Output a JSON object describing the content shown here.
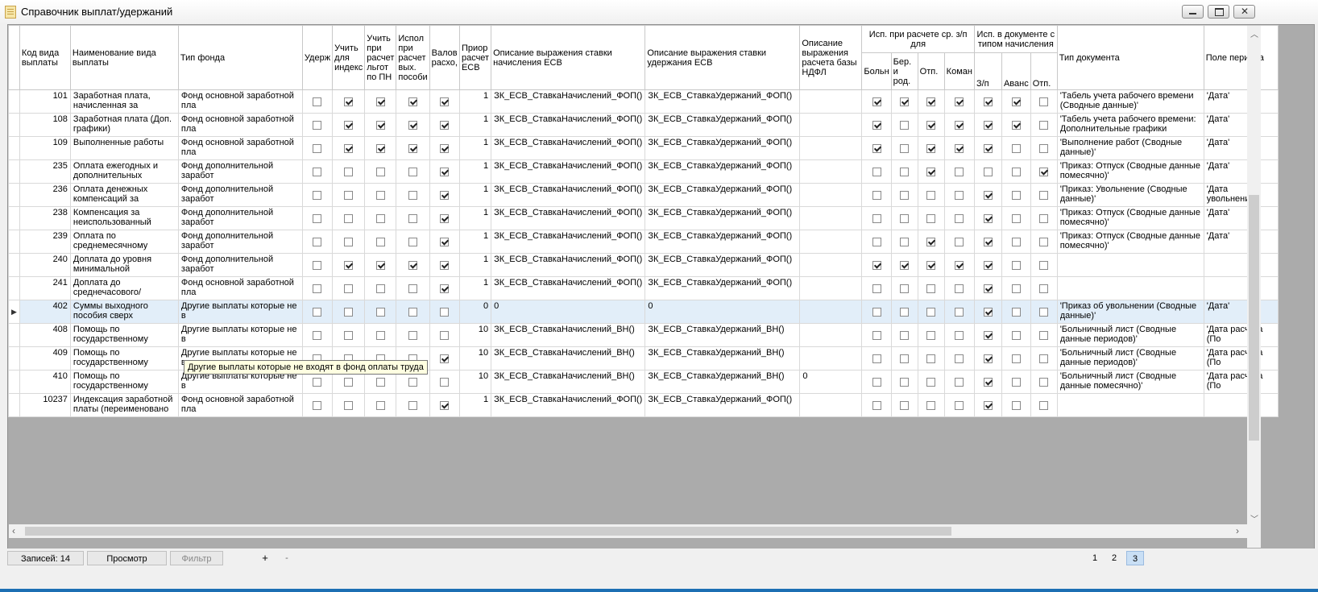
{
  "window": {
    "title": "Справочник выплат/удержаний"
  },
  "columns": {
    "code": "Код вида выплаты",
    "name": "Наименование вида выплаты",
    "fund": "Тип фонда",
    "uderzh": "Удерж",
    "index": "Учить для индекс",
    "lgot": "Учить при расчет льгот по ПН",
    "ispol": "Испол при расчет вых. пособи",
    "valov": "Валов расхо,",
    "prior": "Приор расчет ЕСВ",
    "esv_nach": "Описание выражения ставки начисления ЕСВ",
    "esv_uderzh": "Описание выражения ставки удержания ЕСВ",
    "ndfl": "Описание выражения расчета базы НДФЛ",
    "group_avg": "Исп. при расчете ср. з/п для",
    "boln": "Больн",
    "ber": "Бер. и род.",
    "otp1": "Отп.",
    "koman": "Коман",
    "group_doc": "Исп. в документе с типом начисления",
    "zp": "З/п",
    "avans": "Аванс",
    "otp2": "Отп.",
    "doc_type": "Тип документа",
    "period": "Поле периода"
  },
  "rows": [
    {
      "code": "101",
      "name": "Заработная плата, начисленная за",
      "fund": "Фонд основной заработной пла",
      "checks": [
        0,
        1,
        1,
        1,
        1
      ],
      "prior": "1",
      "esv_nach": "ЗК_ЕСВ_СтавкаНачислений_ФОП()",
      "esv_uderzh": "ЗК_ЕСВ_СтавкаУдержаний_ФОП()",
      "ndfl": "",
      "avg": [
        1,
        1,
        1,
        1
      ],
      "doc": [
        1,
        1,
        0
      ],
      "doc_type": "'Табель учета рабочего времени (Сводные данные)'",
      "period": "'Дата'"
    },
    {
      "code": "108",
      "name": "Заработная плата (Доп. графики)",
      "fund": "Фонд основной заработной пла",
      "checks": [
        0,
        1,
        1,
        1,
        1
      ],
      "prior": "1",
      "esv_nach": "ЗК_ЕСВ_СтавкаНачислений_ФОП()",
      "esv_uderzh": "ЗК_ЕСВ_СтавкаУдержаний_ФОП()",
      "ndfl": "",
      "avg": [
        1,
        0,
        1,
        1
      ],
      "doc": [
        1,
        1,
        0
      ],
      "doc_type": "'Табель учета рабочего времени: Дополнительные графики",
      "period": "'Дата'"
    },
    {
      "code": "109",
      "name": "Выполненные работы",
      "fund": "Фонд основной заработной пла",
      "checks": [
        0,
        1,
        1,
        1,
        1
      ],
      "prior": "1",
      "esv_nach": "ЗК_ЕСВ_СтавкаНачислений_ФОП()",
      "esv_uderzh": "ЗК_ЕСВ_СтавкаУдержаний_ФОП()",
      "ndfl": "",
      "avg": [
        1,
        0,
        1,
        1
      ],
      "doc": [
        1,
        0,
        0
      ],
      "doc_type": "'Выполнение работ (Сводные данные)'",
      "period": "'Дата'"
    },
    {
      "code": "235",
      "name": "Оплата ежегодных и дополнительных отпусков",
      "fund": "Фонд дополнительной заработ",
      "checks": [
        0,
        0,
        0,
        0,
        1
      ],
      "prior": "1",
      "esv_nach": "ЗК_ЕСВ_СтавкаНачислений_ФОП()",
      "esv_uderzh": "ЗК_ЕСВ_СтавкаУдержаний_ФОП()",
      "ndfl": "",
      "avg": [
        0,
        0,
        1,
        0
      ],
      "doc": [
        0,
        0,
        1
      ],
      "doc_type": "'Приказ: Отпуск (Сводные данные помесячно)'",
      "period": "'Дата'"
    },
    {
      "code": "236",
      "name": "Оплата денежных компенсаций за",
      "fund": "Фонд дополнительной заработ",
      "checks": [
        0,
        0,
        0,
        0,
        1
      ],
      "prior": "1",
      "esv_nach": "ЗК_ЕСВ_СтавкаНачислений_ФОП()",
      "esv_uderzh": "ЗК_ЕСВ_СтавкаУдержаний_ФОП()",
      "ndfl": "",
      "avg": [
        0,
        0,
        0,
        0
      ],
      "doc": [
        1,
        0,
        0
      ],
      "doc_type": "'Приказ: Увольнение (Сводные данные)'",
      "period": "'Дата увольнения'"
    },
    {
      "code": "238",
      "name": "Компенсация за неиспользованный отпуск",
      "fund": "Фонд дополнительной заработ",
      "checks": [
        0,
        0,
        0,
        0,
        1
      ],
      "prior": "1",
      "esv_nach": "ЗК_ЕСВ_СтавкаНачислений_ФОП()",
      "esv_uderzh": "ЗК_ЕСВ_СтавкаУдержаний_ФОП()",
      "ndfl": "",
      "avg": [
        0,
        0,
        0,
        0
      ],
      "doc": [
        1,
        0,
        0
      ],
      "doc_type": "'Приказ: Отпуск (Сводные данные помесячно)'",
      "period": "'Дата'"
    },
    {
      "code": "239",
      "name": "Оплата по среднемесячному",
      "fund": "Фонд дополнительной заработ",
      "checks": [
        0,
        0,
        0,
        0,
        1
      ],
      "prior": "1",
      "esv_nach": "ЗК_ЕСВ_СтавкаНачислений_ФОП()",
      "esv_uderzh": "ЗК_ЕСВ_СтавкаУдержаний_ФОП()",
      "ndfl": "",
      "avg": [
        0,
        0,
        1,
        0
      ],
      "doc": [
        1,
        0,
        0
      ],
      "doc_type": "'Приказ: Отпуск (Сводные данные помесячно)'",
      "period": "'Дата'"
    },
    {
      "code": "240",
      "name": "Доплата до уровня минимальной заработной",
      "fund": "Фонд дополнительной заработ",
      "checks": [
        0,
        1,
        1,
        1,
        1
      ],
      "prior": "1",
      "esv_nach": "ЗК_ЕСВ_СтавкаНачислений_ФОП()",
      "esv_uderzh": "ЗК_ЕСВ_СтавкаУдержаний_ФОП()",
      "ndfl": "",
      "avg": [
        1,
        1,
        1,
        1
      ],
      "doc": [
        1,
        0,
        0
      ],
      "doc_type": "",
      "period": ""
    },
    {
      "code": "241",
      "name": "Доплата до среднечасового/среднедне",
      "fund": "Фонд основной заработной пла",
      "checks": [
        0,
        0,
        0,
        0,
        1
      ],
      "prior": "1",
      "esv_nach": "ЗК_ЕСВ_СтавкаНачислений_ФОП()",
      "esv_uderzh": "ЗК_ЕСВ_СтавкаУдержаний_ФОП()",
      "ndfl": "",
      "avg": [
        0,
        0,
        0,
        0
      ],
      "doc": [
        1,
        0,
        0
      ],
      "doc_type": "",
      "period": ""
    },
    {
      "code": "402",
      "name": "Суммы выходного пособия сверх установленных",
      "fund": "Другие выплаты которые не в",
      "checks": [
        0,
        0,
        0,
        0,
        0
      ],
      "prior": "0",
      "esv_nach": "0",
      "esv_uderzh": "0",
      "ndfl": "",
      "avg": [
        0,
        0,
        0,
        0
      ],
      "doc": [
        1,
        0,
        0
      ],
      "doc_type": "'Приказ об увольнении (Сводные данные)'",
      "period": "'Дата'",
      "selected": true
    },
    {
      "code": "408",
      "name": "Помощь по государственному",
      "fund": "Другие выплаты которые не в",
      "checks": [
        0,
        0,
        0,
        0,
        0
      ],
      "prior": "10",
      "esv_nach": "ЗК_ЕСВ_СтавкаНачислений_ВН()",
      "esv_uderzh": "ЗК_ЕСВ_СтавкаУдержаний_ВН()",
      "ndfl": "",
      "avg": [
        0,
        0,
        0,
        0
      ],
      "doc": [
        1,
        0,
        0
      ],
      "doc_type": "'Больничный лист (Сводные данные периодов)'",
      "period": "'Дата расчета (По"
    },
    {
      "code": "409",
      "name": "Помощь по государственному",
      "fund": "Другие выплаты которые не в",
      "checks": [
        0,
        0,
        0,
        0,
        1
      ],
      "prior": "10",
      "esv_nach": "ЗК_ЕСВ_СтавкаНачислений_ВН()",
      "esv_uderzh": "ЗК_ЕСВ_СтавкаУдержаний_ВН()",
      "ndfl": "",
      "avg": [
        0,
        0,
        0,
        0
      ],
      "doc": [
        1,
        0,
        0
      ],
      "doc_type": "'Больничный лист (Сводные данные периодов)'",
      "period": "'Дата расчета (По"
    },
    {
      "code": "410",
      "name": "Помощь по государственному",
      "fund": "Другие выплаты которые не в",
      "checks": [
        0,
        0,
        0,
        0,
        0
      ],
      "prior": "10",
      "esv_nach": "ЗК_ЕСВ_СтавкаНачислений_ВН()",
      "esv_uderzh": "ЗК_ЕСВ_СтавкаУдержаний_ВН()",
      "ndfl": "0",
      "avg": [
        0,
        0,
        0,
        0
      ],
      "doc": [
        1,
        0,
        0
      ],
      "doc_type": "'Больничный лист (Сводные данные помесячно)'",
      "period": "'Дата расчета (По"
    },
    {
      "code": "10237",
      "name": "Индексация заработной платы (переименовано",
      "fund": "Фонд основной заработной пла",
      "checks": [
        0,
        0,
        0,
        0,
        1
      ],
      "prior": "1",
      "esv_nach": "ЗК_ЕСВ_СтавкаНачислений_ФОП()",
      "esv_uderzh": "ЗК_ЕСВ_СтавкаУдержаний_ФОП()",
      "ndfl": "",
      "avg": [
        0,
        0,
        0,
        0
      ],
      "doc": [
        1,
        0,
        0
      ],
      "doc_type": "",
      "period": ""
    }
  ],
  "tooltip": "Другие выплаты которые не входят в фонд оплаты труда",
  "status": {
    "records": "Записей: 14",
    "view": "Просмотр",
    "filter": "Фильтр",
    "add": "+",
    "remove": "-",
    "pages": [
      "1",
      "2",
      "3"
    ],
    "active_page": "3"
  }
}
